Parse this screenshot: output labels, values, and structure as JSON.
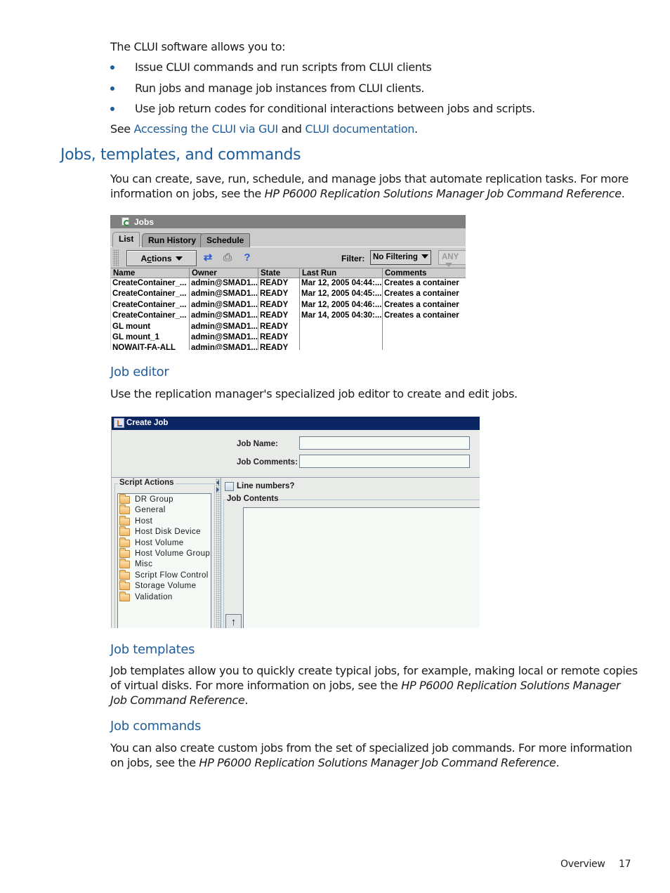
{
  "intro": {
    "lead": "The CLUI software allows you to:",
    "bullets": [
      "Issue CLUI commands and run scripts from CLUI clients",
      "Run jobs and manage job instances from CLUI clients.",
      "Use job return codes for conditional interactions between jobs and scripts."
    ],
    "see_prefix": "See ",
    "link1": "Accessing the CLUI via GUI",
    "and": " and ",
    "link2": "CLUI documentation",
    "period": "."
  },
  "section": {
    "title": "Jobs, templates, and commands",
    "para_line1": "You can create, save, run, schedule, and manage jobs that automate replication tasks. For more",
    "para_line2_prefix": "information on jobs, see the ",
    "para_line2_ref": "HP P6000 Replication Solutions Manager Job Command Reference",
    "para_line2_suffix": "."
  },
  "jobs_window": {
    "title": "Jobs",
    "tabs": [
      "List",
      "Run History",
      "Schedule"
    ],
    "active_tab": "List",
    "actions_label_pre": "A",
    "actions_label_mnemonic": "c",
    "actions_label_post": "tions",
    "toolbar_icons": [
      "refresh-icon",
      "print-icon",
      "help-icon"
    ],
    "filter_label": "Filter:",
    "filter_value": "No Filtering",
    "any_value": "ANY",
    "columns": [
      "Name",
      "Owner",
      "State",
      "Last Run",
      "Comments"
    ],
    "rows": [
      [
        "CreateContainer_...",
        "admin@SMAD1...",
        "READY",
        "Mar 12, 2005 04:44:...",
        "Creates a container"
      ],
      [
        "CreateContainer_...",
        "admin@SMAD1...",
        "READY",
        "Mar 12, 2005 04:45:...",
        "Creates a container"
      ],
      [
        "CreateContainer_...",
        "admin@SMAD1...",
        "READY",
        "Mar 12, 2005 04:46:...",
        "Creates a container"
      ],
      [
        "CreateContainer_...",
        "admin@SMAD1...",
        "READY",
        "Mar 14, 2005 04:30:...",
        "Creates a container"
      ],
      [
        "GL mount",
        "admin@SMAD1...",
        "READY",
        "",
        ""
      ],
      [
        "GL mount_1",
        "admin@SMAD1...",
        "READY",
        "",
        ""
      ],
      [
        "NOWAIT-FA-ALL",
        "admin@SMAD1...",
        "READY",
        "",
        ""
      ]
    ]
  },
  "job_editor": {
    "heading": "Job editor",
    "text": "Use the replication manager's specialized job editor to create and edit jobs."
  },
  "create_job_window": {
    "title": "Create Job",
    "job_name_label": "Job Name:",
    "job_name_value": "",
    "job_comments_label": "Job Comments:",
    "job_comments_value": "",
    "script_actions_label": "Script Actions",
    "script_actions": [
      "DR Group",
      "General",
      "Host",
      "Host Disk Device",
      "Host Volume",
      "Host Volume Group",
      "Misc",
      "Script Flow Control",
      "Storage Volume",
      "Validation"
    ],
    "line_numbers_label": "Line numbers?",
    "line_numbers_checked": false,
    "job_contents_label": "Job Contents",
    "job_contents_value": ""
  },
  "job_templates": {
    "heading": "Job templates",
    "line1": "Job templates allow you to quickly create typical jobs, for example, making local or remote copies",
    "line2_prefix": "of virtual disks. For more information on jobs, see the ",
    "line2_ref": "HP P6000 Replication Solutions Manager",
    "line3_ref": "Job Command Reference",
    "line3_suffix": "."
  },
  "job_commands": {
    "heading": "Job commands",
    "line1": "You can also create custom jobs from the set of specialized job commands. For more information",
    "line2_prefix": "on jobs, see the ",
    "line2_ref": "HP P6000 Replication Solutions Manager Job Command Reference",
    "line2_suffix": "."
  },
  "footer": {
    "section": "Overview",
    "page": "17"
  },
  "colors": {
    "heading_blue": "#1f5e9b",
    "link_blue": "#1f5e9b",
    "create_job_titlebar": "#0c2563",
    "jobs_titlebar": "#808080"
  }
}
